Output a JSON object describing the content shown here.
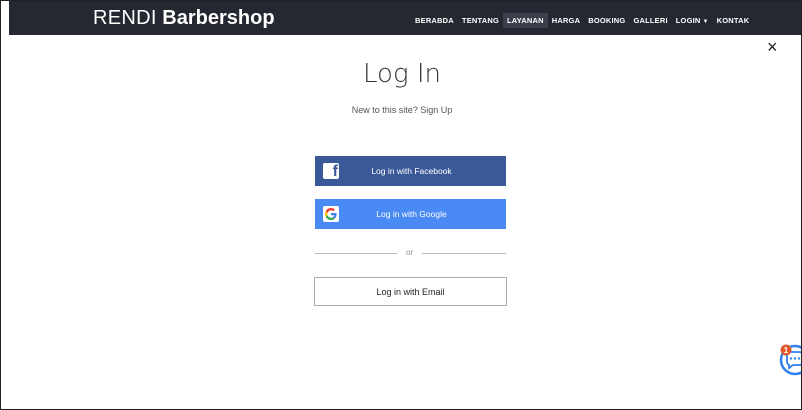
{
  "navbar": {
    "brand_part1": "RENDI",
    "brand_part2": "Barbershop",
    "items": [
      {
        "label": "BERABDA"
      },
      {
        "label": "TENTANG"
      },
      {
        "label": "LAYANAN"
      },
      {
        "label": "HARGA"
      },
      {
        "label": "BOOKING"
      },
      {
        "label": "GALLERI"
      },
      {
        "label": "LOGIN"
      },
      {
        "label": "KONTAK"
      }
    ],
    "active_item": "LAYANAN",
    "background": "#252831"
  },
  "dialog": {
    "close_symbol": "×",
    "title": "Log In",
    "subtitle_text": "New to this site?",
    "signup_link": "Sign Up",
    "facebook_button": "Log in with Facebook",
    "google_button": "Log in with Google",
    "divider_text": "or",
    "email_button": "Log in with Email"
  },
  "chat_widget": {
    "badge_count": "1",
    "icon": "chat-bubble-icon"
  },
  "colors": {
    "facebook": "#3b5998",
    "google": "#4a8af4",
    "chat": "#2f80ed",
    "badge": "#e05a2b"
  }
}
